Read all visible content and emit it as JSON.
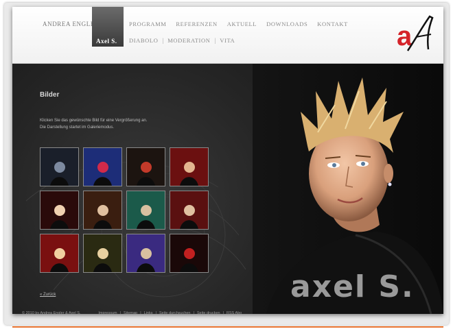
{
  "header": {
    "brand_link": "Andrea Engler",
    "active_tab": "Axel S.",
    "nav_main": [
      "Programm",
      "Referenzen",
      "Aktuell",
      "Downloads",
      "Kontakt"
    ],
    "nav_sub": [
      "Diabolo",
      "Moderation",
      "Vita"
    ],
    "logo_text": "aA"
  },
  "content": {
    "title": "Bilder",
    "intro_line1": "Klicken Sie das gewünschte Bild für eine Vergrößerung an.",
    "intro_line2": "Die Darstellung startet im Galeriemodus.",
    "back_link": "« Zurück",
    "signature": "axel S."
  },
  "gallery": [
    {
      "name": "thumb-1",
      "tone": "#1a1f2a",
      "accent": "#7d8aa0"
    },
    {
      "name": "thumb-2",
      "tone": "#1d2d78",
      "accent": "#d12a4a"
    },
    {
      "name": "thumb-3",
      "tone": "#1c1410",
      "accent": "#c33a2a"
    },
    {
      "name": "thumb-4",
      "tone": "#6b1010",
      "accent": "#e3b690"
    },
    {
      "name": "thumb-5",
      "tone": "#2a0a0a",
      "accent": "#f0d0b0"
    },
    {
      "name": "thumb-6",
      "tone": "#3a1e10",
      "accent": "#e0c0a0"
    },
    {
      "name": "thumb-7",
      "tone": "#1b5a4a",
      "accent": "#d8c0a0"
    },
    {
      "name": "thumb-8",
      "tone": "#5a1010",
      "accent": "#e0c0a0"
    },
    {
      "name": "thumb-9",
      "tone": "#7a1010",
      "accent": "#f0d0a0"
    },
    {
      "name": "thumb-10",
      "tone": "#2a2a12",
      "accent": "#e8d0a0"
    },
    {
      "name": "thumb-11",
      "tone": "#3a2a80",
      "accent": "#d8c0a0"
    },
    {
      "name": "thumb-12",
      "tone": "#1a0808",
      "accent": "#c12020"
    }
  ],
  "footer": {
    "copyright": "© 2010 by Andrea Engler & Axel S.",
    "links": [
      "Impressum",
      "Sitemap",
      "Links",
      "Seite durchsuchen",
      "Seite drucken",
      "RSS Abo"
    ]
  },
  "colors": {
    "accent_orange": "#e8732f",
    "logo_red": "#d4232a"
  }
}
